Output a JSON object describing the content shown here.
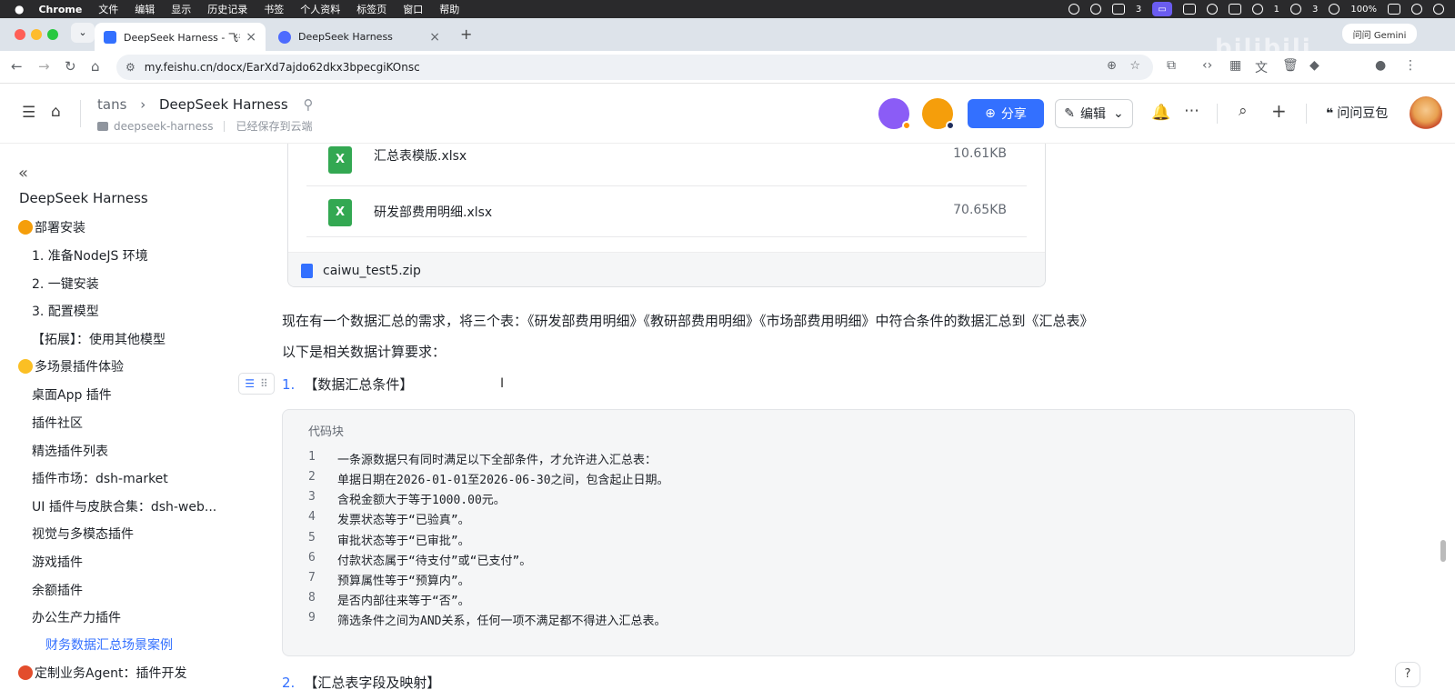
{
  "macbar": {
    "app": "Chrome",
    "menus": [
      "文件",
      "编辑",
      "显示",
      "历史记录",
      "书签",
      "个人资料",
      "标签页",
      "窗口",
      "帮助"
    ],
    "right": {
      "people_count": "3",
      "notif_count": "1",
      "wechat_count": "3",
      "battery": "100%",
      "time_hint": ""
    }
  },
  "browser": {
    "tabs": [
      {
        "title": "DeepSeek Harness - 飞书云文",
        "active": true
      },
      {
        "title": "DeepSeek Harness",
        "active": false
      }
    ],
    "url": "my.feishu.cn/docx/EarXd7ajdo62dkx3bpecgiKOnsc",
    "gemini_label": "问问 Gemini"
  },
  "header": {
    "breadcrumb_root": "tans",
    "breadcrumb_sep": "›",
    "doc_title": "DeepSeek Harness",
    "folder": "deepseek-harness",
    "save_status": "已经保存到云端",
    "share_label": "分享",
    "edit_label": "编辑",
    "ask_doubao": "问问豆包"
  },
  "sidebar": {
    "collapse_icon": "«",
    "title": "DeepSeek Harness",
    "items": [
      {
        "label": "部署安装",
        "level": 0,
        "emoji": "orange"
      },
      {
        "label": "1. 准备NodeJS 环境",
        "level": 1
      },
      {
        "label": "2. 一键安装",
        "level": 1
      },
      {
        "label": "3. 配置模型",
        "level": 1
      },
      {
        "label": "【拓展】：使用其他模型",
        "level": 1
      },
      {
        "label": "多场景插件体验",
        "level": 0,
        "emoji": "yellow"
      },
      {
        "label": "桌面App 插件",
        "level": 1
      },
      {
        "label": "插件社区",
        "level": 1
      },
      {
        "label": "精选插件列表",
        "level": 1
      },
      {
        "label": "插件市场：dsh-market",
        "level": 1
      },
      {
        "label": "UI 插件与皮肤合集：dsh-web...",
        "level": 1
      },
      {
        "label": "视觉与多模态插件",
        "level": 1
      },
      {
        "label": "游戏插件",
        "level": 1
      },
      {
        "label": "余额插件",
        "level": 1
      },
      {
        "label": "办公生产力插件",
        "level": 1
      },
      {
        "label": "财务数据汇总场景案例",
        "level": 2,
        "active": true
      },
      {
        "label": "定制业务Agent：插件开发",
        "level": 0,
        "emoji": "red"
      }
    ]
  },
  "doc": {
    "files": [
      {
        "name": "汇总表模版.xlsx",
        "size": "10.61KB"
      },
      {
        "name": "研发部费用明细.xlsx",
        "size": "70.65KB"
      }
    ],
    "zip_name": "caiwu_test5.zip",
    "para1": "现在有一个数据汇总的需求，将三个表：《研发部费用明细》《教研部费用明细》《市场部费用明细》中符合条件的数据汇总到《汇总表》",
    "para2": "以下是相关数据计算要求：",
    "h1_num": "1.",
    "h1_text": "【数据汇总条件】",
    "code_title": "代码块",
    "code_lines": [
      "一条源数据只有同时满足以下全部条件，才允许进入汇总表：",
      "单据日期在2026-01-01至2026-06-30之间，包含起止日期。",
      "含税金额大于等于1000.00元。",
      "发票状态等于“已验真”。",
      "审批状态等于“已审批”。",
      "付款状态属于“待支付”或“已支付”。",
      "预算属性等于“预算内”。",
      "是否内部往来等于“否”。",
      "筛选条件之间为AND关系，任何一项不满足都不得进入汇总表。"
    ],
    "h2_num": "2.",
    "h2_text": "【汇总表字段及映射】"
  },
  "colors": {
    "accent": "#3370ff",
    "excel": "#33a852",
    "sidebar_active": "#3370ff"
  }
}
